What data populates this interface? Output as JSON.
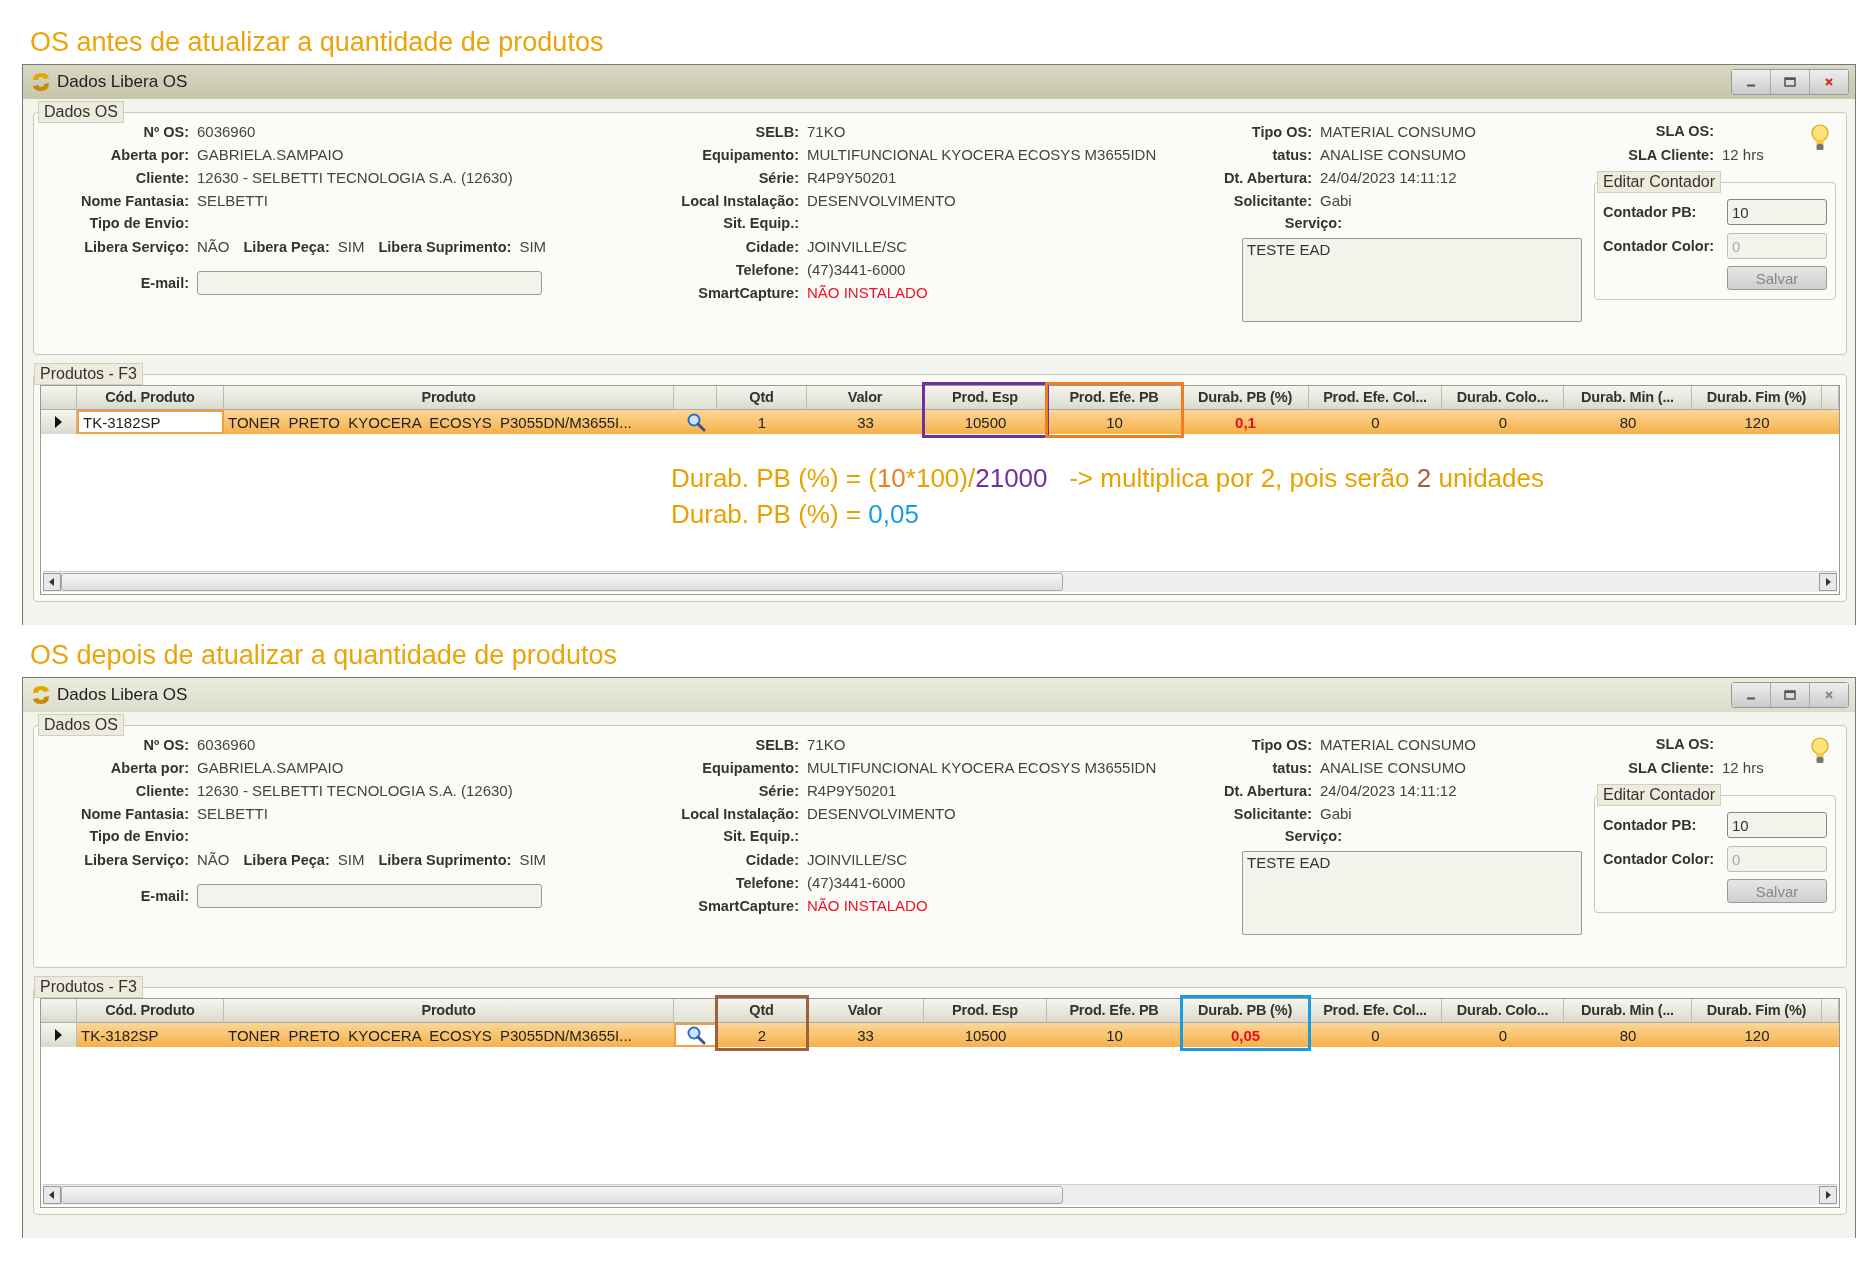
{
  "sections": [
    {
      "caption": "OS antes de atualizar a quantidade de produtos",
      "window": {
        "title": "Dados Libera OS",
        "active": true
      },
      "dados": {
        "legend": "Dados OS",
        "columns": [
          [
            {
              "kind": "text",
              "label": "Nº OS:",
              "value": "6036960"
            },
            {
              "kind": "text",
              "label": "Aberta por:",
              "value": "GABRIELA.SAMPAIO"
            },
            {
              "kind": "text",
              "label": "Cliente:",
              "value": "12630 - SELBETTI TECNOLOGIA S.A. (12630)"
            },
            {
              "kind": "text",
              "label": "Nome Fantasia:",
              "value": "SELBETTI"
            },
            {
              "kind": "text",
              "label": "Tipo de Envio:"
            },
            {
              "kind": "multi",
              "label": "Libera Serviço:",
              "value": "NÃO",
              "extra": [
                {
                  "label": "Libera Peça:",
                  "value": "SIM"
                },
                {
                  "label": "Libera Suprimento:",
                  "value": "SIM"
                }
              ]
            },
            {
              "kind": "input",
              "label": "E-mail:"
            }
          ],
          [
            {
              "kind": "text",
              "label": "SELB:",
              "value": "71KO"
            },
            {
              "kind": "text",
              "label": "Equipamento:",
              "value": "MULTIFUNCIONAL KYOCERA ECOSYS M3655IDN"
            },
            {
              "kind": "text",
              "label": "Série:",
              "value": "R4P9Y50201"
            },
            {
              "kind": "text",
              "label": "Local Instalação:",
              "value": "DESENVOLVIMENTO"
            },
            {
              "kind": "text",
              "label": "Sit. Equip.:"
            },
            {
              "kind": "text",
              "label": "Cidade:",
              "value": "JOINVILLE/SC"
            },
            {
              "kind": "text",
              "label": "Telefone:",
              "value": "(47)3441-6000"
            },
            {
              "kind": "alert",
              "label": "SmartCapture:",
              "value": "NÃO INSTALADO"
            }
          ],
          [
            {
              "kind": "text",
              "label": "Tipo OS:",
              "value": "MATERIAL CONSUMO"
            },
            {
              "kind": "text",
              "label": "tatus:",
              "value": "ANALISE CONSUMO"
            },
            {
              "kind": "text",
              "label": "Dt. Abertura:",
              "value": "24/04/2023 14:11:12"
            },
            {
              "kind": "text",
              "label": "Solicitante:",
              "value": "Gabi"
            },
            {
              "kind": "textarea",
              "label": "Serviço:",
              "value": "TESTE EAD"
            }
          ]
        ],
        "sla": [
          {
            "label": "SLA OS:"
          },
          {
            "label": "SLA Cliente:",
            "value": "12 hrs"
          }
        ],
        "contador": {
          "legend": "Editar Contador",
          "fields": [
            {
              "label": "Contador PB:",
              "value": "10",
              "disabled": false
            },
            {
              "label": "Contador Color:",
              "value": "0",
              "disabled": true
            }
          ],
          "button": {
            "label": "Salvar",
            "disabled": true
          }
        }
      },
      "produtos": {
        "legend": "Produtos - F3",
        "columns": [
          {
            "label": "Cód. Produto"
          },
          {
            "label": "Produto"
          },
          {
            "kind": "icon"
          },
          {
            "label": "Qtd"
          },
          {
            "label": "Valor"
          },
          {
            "label": "Prod. Esp",
            "color": "#7030a0"
          },
          {
            "label": "Prod. Efe. PB",
            "color": "#f07d22"
          },
          {
            "label": "Durab. PB (%)"
          },
          {
            "label": "Prod. Efe. Col..."
          },
          {
            "label": "Durab. Colo..."
          },
          {
            "label": "Durab. Min (..."
          },
          {
            "label": "Durab. Fim (%)"
          }
        ],
        "rows": [
          {
            "selected": true,
            "cells": [
              {
                "kind": "text",
                "text": "TK-3182SP",
                "focused": true
              },
              {
                "kind": "text",
                "text": "TONER  PRETO  KYOCERA  ECOSYS  P3055DN/M3655I...",
                "focused": false
              },
              {
                "kind": "search",
                "focused": false
              },
              {
                "kind": "text",
                "text": "1",
                "focused": false
              },
              {
                "kind": "text",
                "text": "33",
                "focused": false
              },
              {
                "kind": "text",
                "text": "10500",
                "focused": false
              },
              {
                "kind": "text",
                "text": "10",
                "focused": false
              },
              {
                "kind": "alert",
                "text": "0,1",
                "focused": false
              },
              {
                "kind": "text",
                "text": "0",
                "focused": false
              },
              {
                "kind": "text",
                "text": "0",
                "focused": false
              },
              {
                "kind": "text",
                "text": "80",
                "focused": false
              },
              {
                "kind": "text",
                "text": "120",
                "focused": false
              }
            ]
          }
        ],
        "annotation": [
          {
            "segments": [
              {
                "text": "Durab. PB (%) = (",
                "color": "#e8a200"
              },
              {
                "text": "10",
                "color": "#f07d22"
              },
              {
                "text": "*100)/",
                "color": "#e8a200"
              },
              {
                "text": "21000",
                "color": "#7030a0"
              },
              {
                "text": "   -> multiplica por 2, pois serão ",
                "color": "#e8a200"
              },
              {
                "text": "2",
                "color": "#a0603a"
              },
              {
                "text": " unidades",
                "color": "#e8a200"
              }
            ]
          },
          {
            "segments": [
              {
                "text": "Durab. PB (%) = ",
                "color": "#e8a200"
              },
              {
                "text": "0,05",
                "color": "#1c9ce0"
              }
            ]
          }
        ]
      }
    },
    {
      "caption": "OS depois de atualizar a quantidade de produtos",
      "window": {
        "title": "Dados Libera OS",
        "active": false
      },
      "dados": {
        "legend": "Dados OS",
        "columns": [
          [
            {
              "kind": "text",
              "label": "Nº OS:",
              "value": "6036960"
            },
            {
              "kind": "text",
              "label": "Aberta por:",
              "value": "GABRIELA.SAMPAIO"
            },
            {
              "kind": "text",
              "label": "Cliente:",
              "value": "12630 - SELBETTI TECNOLOGIA S.A. (12630)"
            },
            {
              "kind": "text",
              "label": "Nome Fantasia:",
              "value": "SELBETTI"
            },
            {
              "kind": "text",
              "label": "Tipo de Envio:"
            },
            {
              "kind": "multi",
              "label": "Libera Serviço:",
              "value": "NÃO",
              "extra": [
                {
                  "label": "Libera Peça:",
                  "value": "SIM"
                },
                {
                  "label": "Libera Suprimento:",
                  "value": "SIM"
                }
              ]
            },
            {
              "kind": "input",
              "label": "E-mail:"
            }
          ],
          [
            {
              "kind": "text",
              "label": "SELB:",
              "value": "71KO"
            },
            {
              "kind": "text",
              "label": "Equipamento:",
              "value": "MULTIFUNCIONAL KYOCERA ECOSYS M3655IDN"
            },
            {
              "kind": "text",
              "label": "Série:",
              "value": "R4P9Y50201"
            },
            {
              "kind": "text",
              "label": "Local Instalação:",
              "value": "DESENVOLVIMENTO"
            },
            {
              "kind": "text",
              "label": "Sit. Equip.:"
            },
            {
              "kind": "text",
              "label": "Cidade:",
              "value": "JOINVILLE/SC"
            },
            {
              "kind": "text",
              "label": "Telefone:",
              "value": "(47)3441-6000"
            },
            {
              "kind": "alert",
              "label": "SmartCapture:",
              "value": "NÃO INSTALADO"
            }
          ],
          [
            {
              "kind": "text",
              "label": "Tipo OS:",
              "value": "MATERIAL CONSUMO"
            },
            {
              "kind": "text",
              "label": "tatus:",
              "value": "ANALISE CONSUMO"
            },
            {
              "kind": "text",
              "label": "Dt. Abertura:",
              "value": "24/04/2023 14:11:12"
            },
            {
              "kind": "text",
              "label": "Solicitante:",
              "value": "Gabi"
            },
            {
              "kind": "textarea",
              "label": "Serviço:",
              "value": "TESTE EAD"
            }
          ]
        ],
        "sla": [
          {
            "label": "SLA OS:"
          },
          {
            "label": "SLA Cliente:",
            "value": "12 hrs"
          }
        ],
        "contador": {
          "legend": "Editar Contador",
          "fields": [
            {
              "label": "Contador PB:",
              "value": "10",
              "disabled": false
            },
            {
              "label": "Contador Color:",
              "value": "0",
              "disabled": true
            }
          ],
          "button": {
            "label": "Salvar",
            "disabled": true
          }
        }
      },
      "produtos": {
        "legend": "Produtos - F3",
        "columns": [
          {
            "label": "Cód. Produto"
          },
          {
            "label": "Produto"
          },
          {
            "kind": "icon"
          },
          {
            "label": "Qtd",
            "color": "#a0603a"
          },
          {
            "label": "Valor"
          },
          {
            "label": "Prod. Esp"
          },
          {
            "label": "Prod. Efe. PB"
          },
          {
            "label": "Durab. PB (%)",
            "color": "#1c9ce0"
          },
          {
            "label": "Prod. Efe. Col..."
          },
          {
            "label": "Durab. Colo..."
          },
          {
            "label": "Durab. Min (..."
          },
          {
            "label": "Durab. Fim (%)"
          }
        ],
        "rows": [
          {
            "selected": true,
            "cells": [
              {
                "kind": "text",
                "text": "TK-3182SP",
                "focused": false
              },
              {
                "kind": "text",
                "text": "TONER  PRETO  KYOCERA  ECOSYS  P3055DN/M3655I...",
                "focused": false
              },
              {
                "kind": "search",
                "focused": true
              },
              {
                "kind": "text",
                "text": "2",
                "focused": false
              },
              {
                "kind": "text",
                "text": "33",
                "focused": false
              },
              {
                "kind": "text",
                "text": "10500",
                "focused": false
              },
              {
                "kind": "text",
                "text": "10",
                "focused": false
              },
              {
                "kind": "alert",
                "text": "0,05",
                "focused": false
              },
              {
                "kind": "text",
                "text": "0",
                "focused": false
              },
              {
                "kind": "text",
                "text": "0",
                "focused": false
              },
              {
                "kind": "text",
                "text": "80",
                "focused": false
              },
              {
                "kind": "text",
                "text": "120",
                "focused": false
              }
            ]
          }
        ]
      }
    }
  ]
}
